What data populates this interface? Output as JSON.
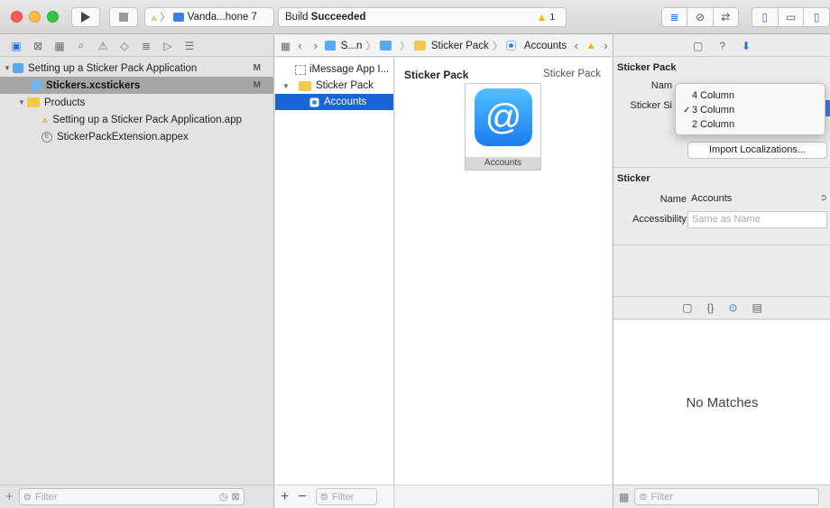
{
  "toolbar": {
    "scheme": "Vanda...hone 7",
    "status_prefix": "Build ",
    "status_bold": "Succeeded",
    "warning_count": "1"
  },
  "navigator": {
    "items": [
      {
        "label": "Setting up a Sticker Pack Application",
        "badge": "M"
      },
      {
        "label": "Stickers.xcstickers",
        "badge": "M"
      },
      {
        "label": "Products"
      },
      {
        "label": "Setting up a Sticker Pack Application.app"
      },
      {
        "label": "StickerPackExtension.appex"
      }
    ],
    "filter_placeholder": "Filter"
  },
  "jumpbar": {
    "crumb1": "S...n",
    "crumb3": "Sticker Pack",
    "crumb4": "Accounts"
  },
  "assetlist": {
    "items": [
      {
        "label": "iMessage App I..."
      },
      {
        "label": "Sticker Pack"
      },
      {
        "label": "Accounts"
      }
    ],
    "filter_placeholder": "Filter"
  },
  "editor": {
    "title": "Sticker Pack",
    "subtitle": "Sticker Pack",
    "sticker_label": "Accounts",
    "sticker_glyph": "@"
  },
  "inspector": {
    "pack_section": "Sticker Pack",
    "name_label": "Nam",
    "size_label": "Sticker Si",
    "import_button": "Import Localizations...",
    "sticker_section": "Sticker",
    "sticker_name_label": "Name",
    "sticker_name_value": "Accounts",
    "accessibility_label": "Accessibility",
    "accessibility_placeholder": "Same as Name",
    "no_matches": "No Matches",
    "filter_placeholder": "Filter"
  },
  "menu": {
    "options": [
      {
        "label": "4 Column",
        "checked": false
      },
      {
        "label": "3 Column",
        "checked": true
      },
      {
        "label": "2 Column",
        "checked": false
      }
    ],
    "check_glyph": "✓"
  }
}
